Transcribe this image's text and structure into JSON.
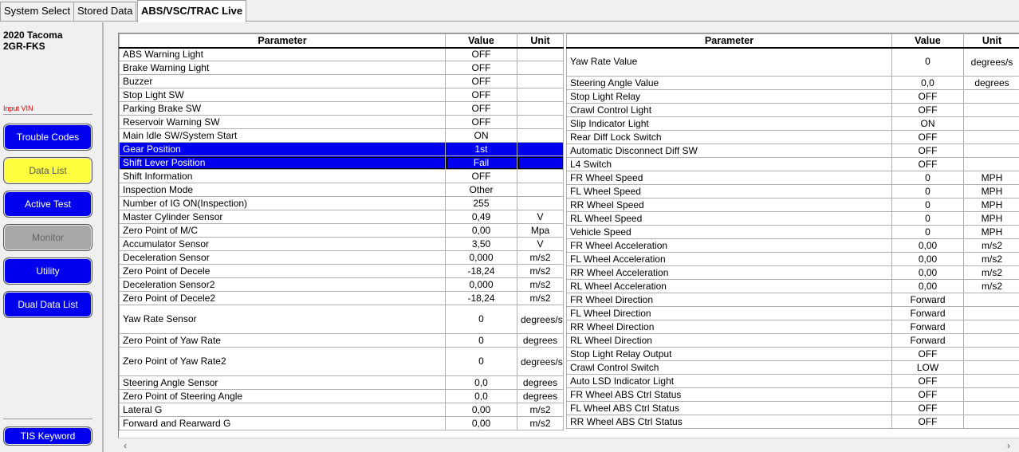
{
  "tabs": [
    {
      "label": "System Select",
      "active": false
    },
    {
      "label": "Stored Data",
      "active": false
    },
    {
      "label": "ABS/VSC/TRAC Live",
      "active": true
    }
  ],
  "vehicle": {
    "model": "2020 Tacoma",
    "engine": "2GR-FKS"
  },
  "sidebar": {
    "input_vin": "Input VIN",
    "buttons": {
      "trouble_codes": "Trouble Codes",
      "data_list": "Data List",
      "active_test": "Active Test",
      "monitor": "Monitor",
      "utility": "Utility",
      "dual_data_list": "Dual Data List",
      "tis_keyword": "TIS Keyword"
    }
  },
  "colors": {
    "button_blue": "#0000ee",
    "button_active": "#ffff40",
    "button_disabled": "#a8a8a8",
    "selection": "#0000ee",
    "vin_label": "#e00000"
  },
  "table_headers": {
    "parameter": "Parameter",
    "value": "Value",
    "unit": "Unit"
  },
  "left_table": [
    {
      "parameter": "ABS Warning Light",
      "value": "OFF",
      "unit": ""
    },
    {
      "parameter": "Brake Warning Light",
      "value": "OFF",
      "unit": ""
    },
    {
      "parameter": "Buzzer",
      "value": "OFF",
      "unit": ""
    },
    {
      "parameter": "Stop Light SW",
      "value": "OFF",
      "unit": ""
    },
    {
      "parameter": "Parking Brake SW",
      "value": "OFF",
      "unit": ""
    },
    {
      "parameter": "Reservoir Warning SW",
      "value": "OFF",
      "unit": ""
    },
    {
      "parameter": "Main Idle SW/System Start",
      "value": "ON",
      "unit": ""
    },
    {
      "parameter": "Gear Position",
      "value": "1st",
      "unit": "",
      "selected": true
    },
    {
      "parameter": "Shift Lever Position",
      "value": "Fail",
      "unit": "",
      "selected": true,
      "focused": true
    },
    {
      "parameter": "Shift Information",
      "value": "OFF",
      "unit": ""
    },
    {
      "parameter": "Inspection Mode",
      "value": "Other",
      "unit": ""
    },
    {
      "parameter": "Number of IG ON(Inspection)",
      "value": "255",
      "unit": ""
    },
    {
      "parameter": "Master Cylinder Sensor",
      "value": "0,49",
      "unit": "V"
    },
    {
      "parameter": "Zero Point of M/C",
      "value": "0,00",
      "unit": "Mpa"
    },
    {
      "parameter": "Accumulator Sensor",
      "value": "3,50",
      "unit": "V"
    },
    {
      "parameter": "Deceleration Sensor",
      "value": "0,000",
      "unit": "m/s2"
    },
    {
      "parameter": "Zero Point of Decele",
      "value": "-18,24",
      "unit": "m/s2"
    },
    {
      "parameter": "Deceleration Sensor2",
      "value": "0,000",
      "unit": "m/s2"
    },
    {
      "parameter": "Zero Point of Decele2",
      "value": "-18,24",
      "unit": "m/s2"
    },
    {
      "parameter": "Yaw Rate Sensor",
      "value": "0",
      "unit": "degrees/s",
      "tall": true
    },
    {
      "parameter": "Zero Point of Yaw Rate",
      "value": "0",
      "unit": "degrees"
    },
    {
      "parameter": "Zero Point of Yaw Rate2",
      "value": "0",
      "unit": "degrees/s",
      "tall": true
    },
    {
      "parameter": "Steering Angle Sensor",
      "value": "0,0",
      "unit": "degrees"
    },
    {
      "parameter": "Zero Point of Steering Angle",
      "value": "0,0",
      "unit": "degrees"
    },
    {
      "parameter": "Lateral G",
      "value": "0,00",
      "unit": "m/s2"
    },
    {
      "parameter": "Forward and Rearward G",
      "value": "0,00",
      "unit": "m/s2"
    }
  ],
  "right_table": [
    {
      "parameter": "Yaw Rate Value",
      "value": "0",
      "unit": "degrees/s",
      "tall": true
    },
    {
      "parameter": "Steering Angle Value",
      "value": "0,0",
      "unit": "degrees"
    },
    {
      "parameter": "Stop Light Relay",
      "value": "OFF",
      "unit": ""
    },
    {
      "parameter": "Crawl Control Light",
      "value": "OFF",
      "unit": ""
    },
    {
      "parameter": "Slip Indicator Light",
      "value": "ON",
      "unit": ""
    },
    {
      "parameter": "Rear Diff Lock Switch",
      "value": "OFF",
      "unit": ""
    },
    {
      "parameter": "Automatic Disconnect Diff SW",
      "value": "OFF",
      "unit": ""
    },
    {
      "parameter": "L4 Switch",
      "value": "OFF",
      "unit": ""
    },
    {
      "parameter": "FR Wheel Speed",
      "value": "0",
      "unit": "MPH"
    },
    {
      "parameter": "FL Wheel Speed",
      "value": "0",
      "unit": "MPH"
    },
    {
      "parameter": "RR Wheel Speed",
      "value": "0",
      "unit": "MPH"
    },
    {
      "parameter": "RL Wheel Speed",
      "value": "0",
      "unit": "MPH"
    },
    {
      "parameter": "Vehicle Speed",
      "value": "0",
      "unit": "MPH"
    },
    {
      "parameter": "FR Wheel Acceleration",
      "value": "0,00",
      "unit": "m/s2"
    },
    {
      "parameter": "FL Wheel Acceleration",
      "value": "0,00",
      "unit": "m/s2"
    },
    {
      "parameter": "RR Wheel Acceleration",
      "value": "0,00",
      "unit": "m/s2"
    },
    {
      "parameter": "RL Wheel Acceleration",
      "value": "0,00",
      "unit": "m/s2"
    },
    {
      "parameter": "FR Wheel Direction",
      "value": "Forward",
      "unit": ""
    },
    {
      "parameter": "FL Wheel Direction",
      "value": "Forward",
      "unit": ""
    },
    {
      "parameter": "RR Wheel Direction",
      "value": "Forward",
      "unit": ""
    },
    {
      "parameter": "RL Wheel Direction",
      "value": "Forward",
      "unit": ""
    },
    {
      "parameter": "Stop Light Relay Output",
      "value": "OFF",
      "unit": ""
    },
    {
      "parameter": "Crawl Control Switch",
      "value": "LOW",
      "unit": ""
    },
    {
      "parameter": "Auto LSD Indicator Light",
      "value": "OFF",
      "unit": ""
    },
    {
      "parameter": "FR Wheel ABS Ctrl Status",
      "value": "OFF",
      "unit": ""
    },
    {
      "parameter": "FL Wheel ABS Ctrl Status",
      "value": "OFF",
      "unit": ""
    },
    {
      "parameter": "RR Wheel ABS Ctrl Status",
      "value": "OFF",
      "unit": ""
    }
  ],
  "scrollbar": {
    "left_arrow": "‹",
    "right_arrow": "›"
  }
}
